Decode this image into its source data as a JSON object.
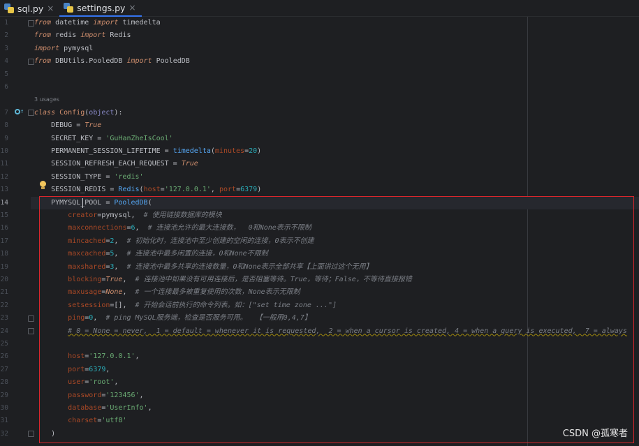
{
  "tabs": [
    {
      "label": "sql.py",
      "active": false,
      "icon": "python-file-icon"
    },
    {
      "label": "settings.py",
      "active": true,
      "icon": "python-file-icon"
    }
  ],
  "usages_hint": "3 usages",
  "lines": [
    {
      "n": "1",
      "tokens": [
        [
          "kwi",
          "from"
        ],
        [
          "plain",
          " datetime "
        ],
        [
          "kwi",
          "import"
        ],
        [
          "plain",
          " timedelta"
        ]
      ]
    },
    {
      "n": "2",
      "tokens": [
        [
          "kwi",
          "from"
        ],
        [
          "plain",
          " redis "
        ],
        [
          "kwi",
          "import"
        ],
        [
          "plain",
          " Redis"
        ]
      ]
    },
    {
      "n": "3",
      "tokens": [
        [
          "kwi",
          "import"
        ],
        [
          "plain",
          " pymysql"
        ]
      ]
    },
    {
      "n": "4",
      "tokens": [
        [
          "kwi",
          "from"
        ],
        [
          "plain",
          " DBUtils.PooledDB "
        ],
        [
          "kwi",
          "import"
        ],
        [
          "plain",
          " PooledDB"
        ]
      ]
    },
    {
      "n": "5",
      "tokens": []
    },
    {
      "n": "6",
      "tokens": []
    },
    {
      "n": "7",
      "tokens": [
        [
          "kwi",
          "class"
        ],
        [
          "plain",
          " "
        ],
        [
          "cfg",
          "Config"
        ],
        [
          "plain",
          "("
        ],
        [
          "builtin",
          "object"
        ],
        [
          "plain",
          "):"
        ]
      ]
    },
    {
      "n": "8",
      "tokens": [
        [
          "plain",
          "    DEBUG = "
        ],
        [
          "kwi",
          "True"
        ]
      ]
    },
    {
      "n": "9",
      "tokens": [
        [
          "plain",
          "    SECRET_KEY = "
        ],
        [
          "str",
          "'GuHanZheIsCool'"
        ]
      ]
    },
    {
      "n": "10",
      "tokens": [
        [
          "plain",
          "    PERMANENT_SESSION_LIFETIME = "
        ],
        [
          "fn",
          "timedelta"
        ],
        [
          "plain",
          "("
        ],
        [
          "param",
          "minutes"
        ],
        [
          "plain",
          "="
        ],
        [
          "num",
          "20"
        ],
        [
          "plain",
          ")"
        ]
      ]
    },
    {
      "n": "11",
      "tokens": [
        [
          "plain",
          "    SESSION_REFRESH_EACH_REQUEST = "
        ],
        [
          "kwi",
          "True"
        ]
      ]
    },
    {
      "n": "12",
      "tokens": [
        [
          "plain",
          "    SESSION_TYPE = "
        ],
        [
          "str",
          "'redis'"
        ]
      ]
    },
    {
      "n": "13",
      "tokens": [
        [
          "plain",
          "    SESSION_REDIS = "
        ],
        [
          "fn",
          "Redis"
        ],
        [
          "plain",
          "("
        ],
        [
          "param",
          "host"
        ],
        [
          "plain",
          "="
        ],
        [
          "str",
          "'127.0.0.1'"
        ],
        [
          "plain",
          ", "
        ],
        [
          "param",
          "port"
        ],
        [
          "plain",
          "="
        ],
        [
          "num",
          "6379"
        ],
        [
          "plain",
          ")"
        ]
      ]
    },
    {
      "n": "14",
      "tokens": [
        [
          "plain",
          "    PYMYSQL_POOL = "
        ],
        [
          "fn",
          "PooledDB"
        ],
        [
          "plain",
          "("
        ]
      ]
    },
    {
      "n": "15",
      "tokens": [
        [
          "plain",
          "        "
        ],
        [
          "param",
          "creator"
        ],
        [
          "plain",
          "=pymysql,  "
        ],
        [
          "cmt",
          "# 使用链接数据库的模块"
        ]
      ]
    },
    {
      "n": "16",
      "tokens": [
        [
          "plain",
          "        "
        ],
        [
          "param",
          "maxconnections"
        ],
        [
          "plain",
          "="
        ],
        [
          "num",
          "6"
        ],
        [
          "plain",
          ",  "
        ],
        [
          "cmt",
          "# 连接池允许的最大连接数，  0和None表示不限制"
        ]
      ]
    },
    {
      "n": "17",
      "tokens": [
        [
          "plain",
          "        "
        ],
        [
          "param",
          "mincached"
        ],
        [
          "plain",
          "="
        ],
        [
          "num",
          "2"
        ],
        [
          "plain",
          ",  "
        ],
        [
          "cmt",
          "# 初始化时，连接池中至少创建的空闲的连接，0表示不创建"
        ]
      ]
    },
    {
      "n": "18",
      "tokens": [
        [
          "plain",
          "        "
        ],
        [
          "param",
          "maxcached"
        ],
        [
          "plain",
          "="
        ],
        [
          "num",
          "5"
        ],
        [
          "plain",
          ",  "
        ],
        [
          "cmt",
          "# 连接池中最多闲置的连接，0和None不限制"
        ]
      ]
    },
    {
      "n": "19",
      "tokens": [
        [
          "plain",
          "        "
        ],
        [
          "param",
          "maxshared"
        ],
        [
          "plain",
          "="
        ],
        [
          "num",
          "3"
        ],
        [
          "plain",
          ",  "
        ],
        [
          "cmt",
          "# 连接池中最多共享的连接数量，0和None表示全部共享【上面讲过这个无用】"
        ]
      ]
    },
    {
      "n": "20",
      "tokens": [
        [
          "plain",
          "        "
        ],
        [
          "param",
          "blocking"
        ],
        [
          "plain",
          "="
        ],
        [
          "kwi",
          "True"
        ],
        [
          "plain",
          ",  "
        ],
        [
          "cmt",
          "# 连接池中如果没有可用连接后，是否阻塞等待。True，等待；False，不等待直接报错"
        ]
      ]
    },
    {
      "n": "21",
      "tokens": [
        [
          "plain",
          "        "
        ],
        [
          "param",
          "maxusage"
        ],
        [
          "plain",
          "="
        ],
        [
          "kwi",
          "None"
        ],
        [
          "plain",
          ",  "
        ],
        [
          "cmt",
          "# 一个连接最多被重复使用的次数，None表示无限制"
        ]
      ]
    },
    {
      "n": "22",
      "tokens": [
        [
          "plain",
          "        "
        ],
        [
          "param",
          "setsession"
        ],
        [
          "plain",
          "=[],  "
        ],
        [
          "cmt",
          "# 开始会话前执行的命令列表。如：[\"set time zone ...\"]"
        ]
      ]
    },
    {
      "n": "23",
      "tokens": [
        [
          "plain",
          "        "
        ],
        [
          "param",
          "ping"
        ],
        [
          "plain",
          "="
        ],
        [
          "num",
          "0"
        ],
        [
          "plain",
          ",  "
        ],
        [
          "cmt",
          "# ping MySQL服务端，检查是否服务可用。  【一般用0,4,7】"
        ]
      ]
    },
    {
      "n": "24",
      "tokens": [
        [
          "plain",
          "        "
        ],
        [
          "cmtsq",
          "# 0 = None = never,  1 = default = whenever it is requested,  2 = when a cursor is created, 4 = when a query is executed,  7 = always"
        ]
      ]
    },
    {
      "n": "25",
      "tokens": []
    },
    {
      "n": "26",
      "tokens": [
        [
          "plain",
          "        "
        ],
        [
          "param",
          "host"
        ],
        [
          "plain",
          "="
        ],
        [
          "str",
          "'127.0.0.1'"
        ],
        [
          "plain",
          ","
        ]
      ]
    },
    {
      "n": "27",
      "tokens": [
        [
          "plain",
          "        "
        ],
        [
          "param",
          "port"
        ],
        [
          "plain",
          "="
        ],
        [
          "num",
          "6379"
        ],
        [
          "plain",
          ","
        ]
      ]
    },
    {
      "n": "28",
      "tokens": [
        [
          "plain",
          "        "
        ],
        [
          "param",
          "user"
        ],
        [
          "plain",
          "="
        ],
        [
          "str",
          "'root'"
        ],
        [
          "plain",
          ","
        ]
      ]
    },
    {
      "n": "29",
      "tokens": [
        [
          "plain",
          "        "
        ],
        [
          "param",
          "password"
        ],
        [
          "plain",
          "="
        ],
        [
          "str",
          "'123456'"
        ],
        [
          "plain",
          ","
        ]
      ]
    },
    {
      "n": "30",
      "tokens": [
        [
          "plain",
          "        "
        ],
        [
          "param",
          "database"
        ],
        [
          "plain",
          "="
        ],
        [
          "str",
          "'UserInfo'"
        ],
        [
          "plain",
          ","
        ]
      ]
    },
    {
      "n": "31",
      "tokens": [
        [
          "plain",
          "        "
        ],
        [
          "param",
          "charset"
        ],
        [
          "plain",
          "="
        ],
        [
          "str",
          "'utf8'"
        ]
      ]
    },
    {
      "n": "32",
      "tokens": [
        [
          "plain",
          "    )"
        ]
      ]
    }
  ],
  "current_line": "14",
  "watermark": "CSDN @孤寒者",
  "colors": {
    "keyword": "#cf8e6d",
    "string": "#6aab73",
    "number": "#2aacb8",
    "function": "#56a8f5",
    "param": "#aa4926",
    "comment": "#7a7e85",
    "highlight_box": "#d9262c"
  }
}
